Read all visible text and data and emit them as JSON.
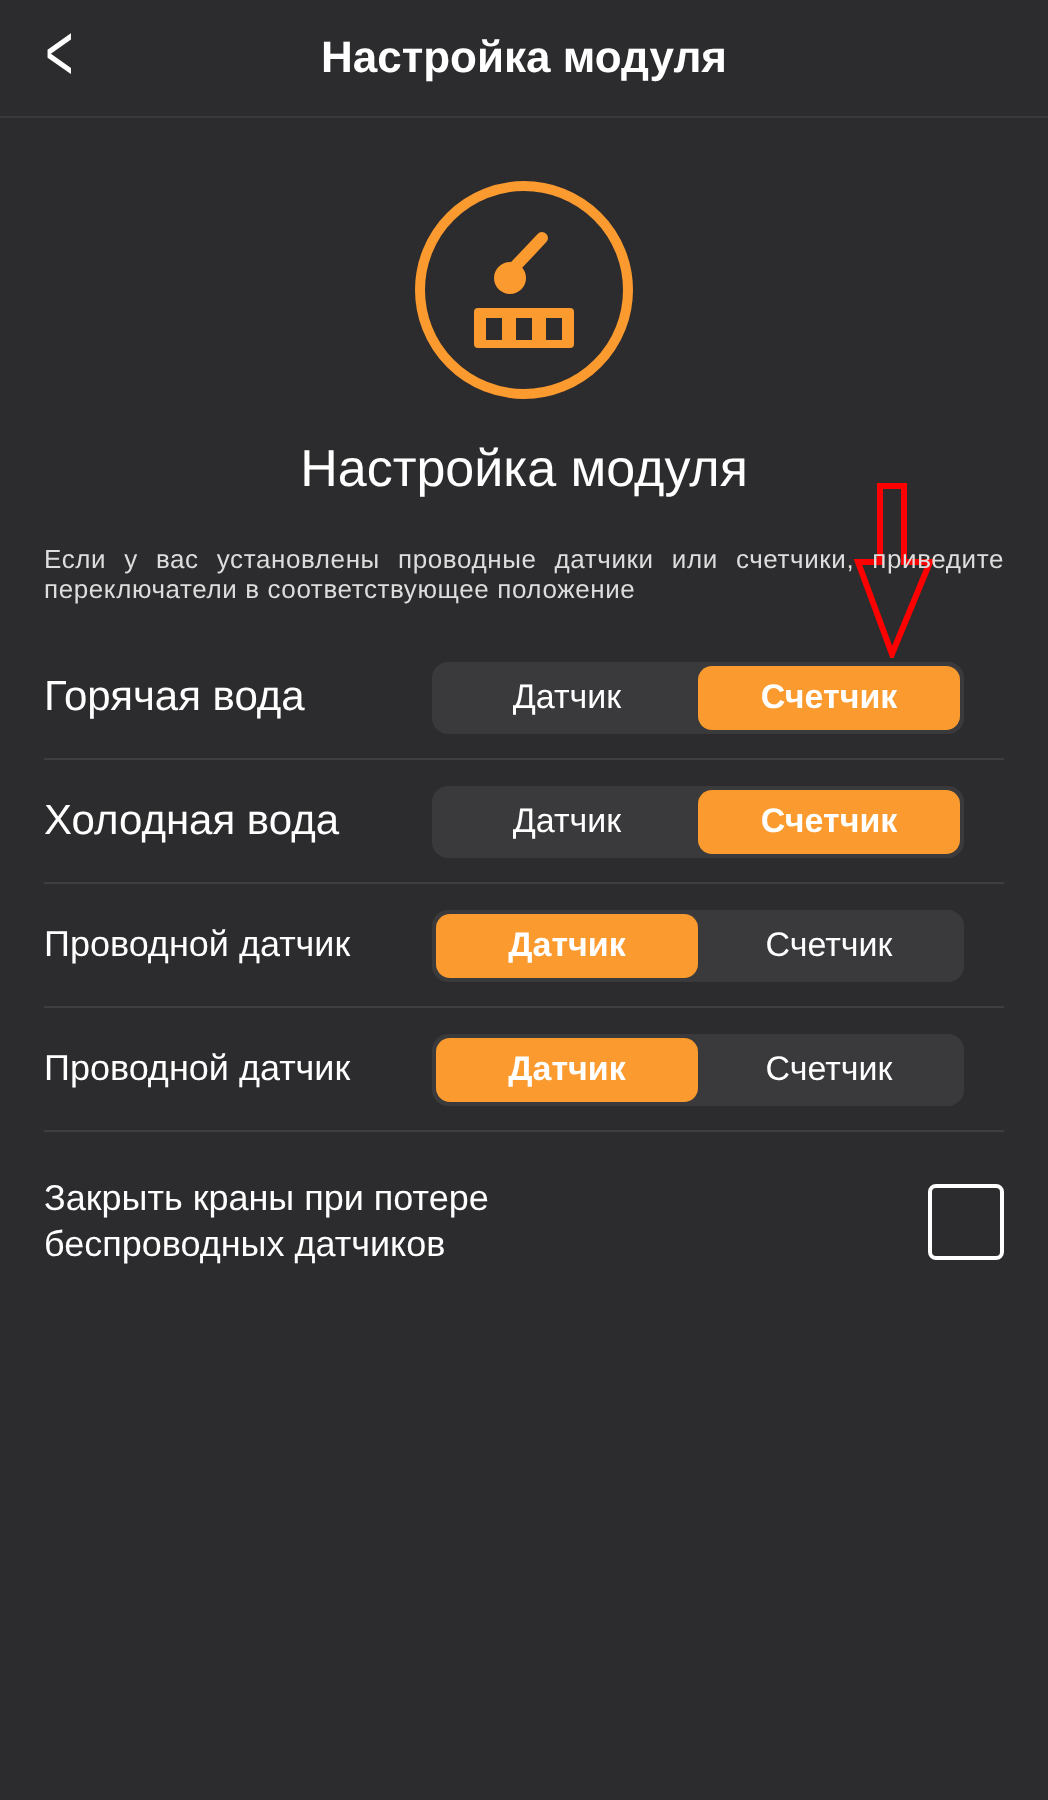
{
  "header": {
    "back": "<",
    "title": "Настройка модуля"
  },
  "heading": "Настройка модуля",
  "description": "Если у вас установлены проводные датчики или счетчики, приведите переключатели в соответствующее положение",
  "rows": [
    {
      "kind": "large",
      "label": "Горячая вода",
      "options": [
        {
          "label": "Датчик",
          "selected": false
        },
        {
          "label": "Счетчик",
          "selected": true
        }
      ]
    },
    {
      "kind": "large",
      "label": "Холодная вода",
      "options": [
        {
          "label": "Датчик",
          "selected": false
        },
        {
          "label": "Счетчик",
          "selected": true
        }
      ]
    },
    {
      "kind": "small",
      "label": "Проводной датчик",
      "options": [
        {
          "label": "Датчик",
          "selected": true
        },
        {
          "label": "Счетчик",
          "selected": false
        }
      ]
    },
    {
      "kind": "small",
      "label": "Проводной датчик",
      "options": [
        {
          "label": "Датчик",
          "selected": true
        },
        {
          "label": "Счетчик",
          "selected": false
        }
      ]
    }
  ],
  "valve_option": {
    "label": "Закрыть краны при потере беспроводных датчиков",
    "checked": false
  }
}
